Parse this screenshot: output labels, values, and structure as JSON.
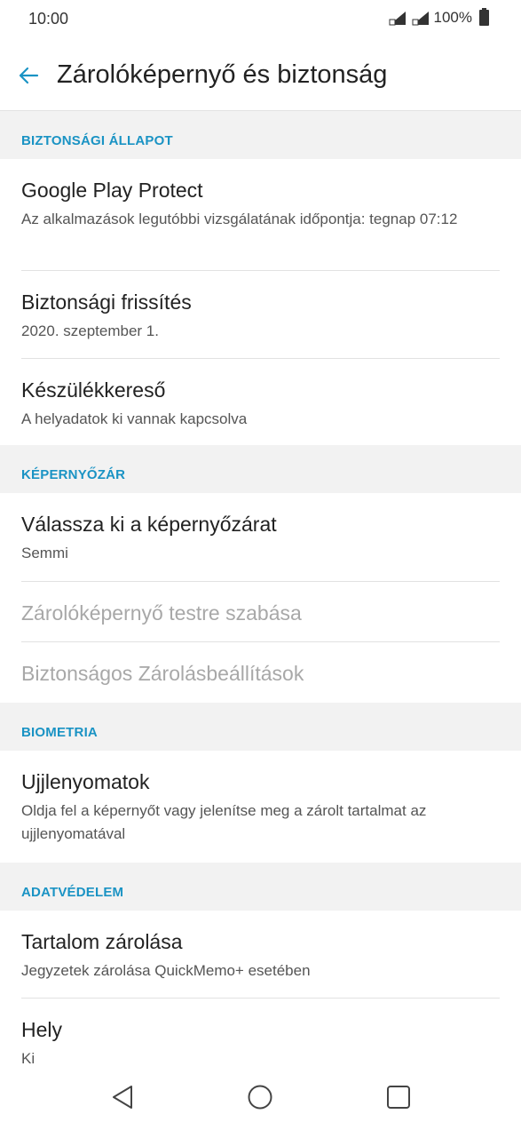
{
  "status": {
    "time": "10:00",
    "battery": "100%"
  },
  "header": {
    "title": "Zárolóképernyő és biztonság"
  },
  "sections": [
    {
      "title": "BIZTONSÁGI ÁLLAPOT"
    },
    {
      "title": "KÉPERNYŐZÁR"
    },
    {
      "title": "BIOMETRIA"
    },
    {
      "title": "ADATVÉDELEM"
    }
  ],
  "items": {
    "play_protect": {
      "title": "Google Play Protect",
      "subtitle": "Az alkalmazások legutóbbi vizsgálatának időpontja: tegnap 07:12"
    },
    "security_update": {
      "title": "Biztonsági frissítés",
      "subtitle": "2020. szeptember 1."
    },
    "device_finder": {
      "title": "Készülékkereső",
      "subtitle": "A helyadatok ki vannak kapcsolva"
    },
    "screen_lock": {
      "title": "Válassza ki a képernyőzárat",
      "subtitle": "Semmi"
    },
    "customize_lock": {
      "title": "Zárolóképernyő testre szabása"
    },
    "secure_lock": {
      "title": "Biztonságos Zárolásbeállítások"
    },
    "fingerprints": {
      "title": "Ujjlenyomatok",
      "subtitle": "Oldja fel a képernyőt vagy jelenítse meg a zárolt tartalmat az ujjlenyomatával"
    },
    "content_lock": {
      "title": "Tartalom zárolása",
      "subtitle": "Jegyzetek zárolása QuickMemo+ esetében"
    },
    "location": {
      "title": "Hely",
      "subtitle": "Ki"
    }
  },
  "colors": {
    "accent": "#1a93c4",
    "section_bg": "#f2f2f2",
    "disabled": "#a8a8a8"
  },
  "icons": {
    "back": "arrow-left-icon",
    "nav_back": "triangle-back-icon",
    "nav_home": "circle-home-icon",
    "nav_recent": "square-recent-icon"
  }
}
